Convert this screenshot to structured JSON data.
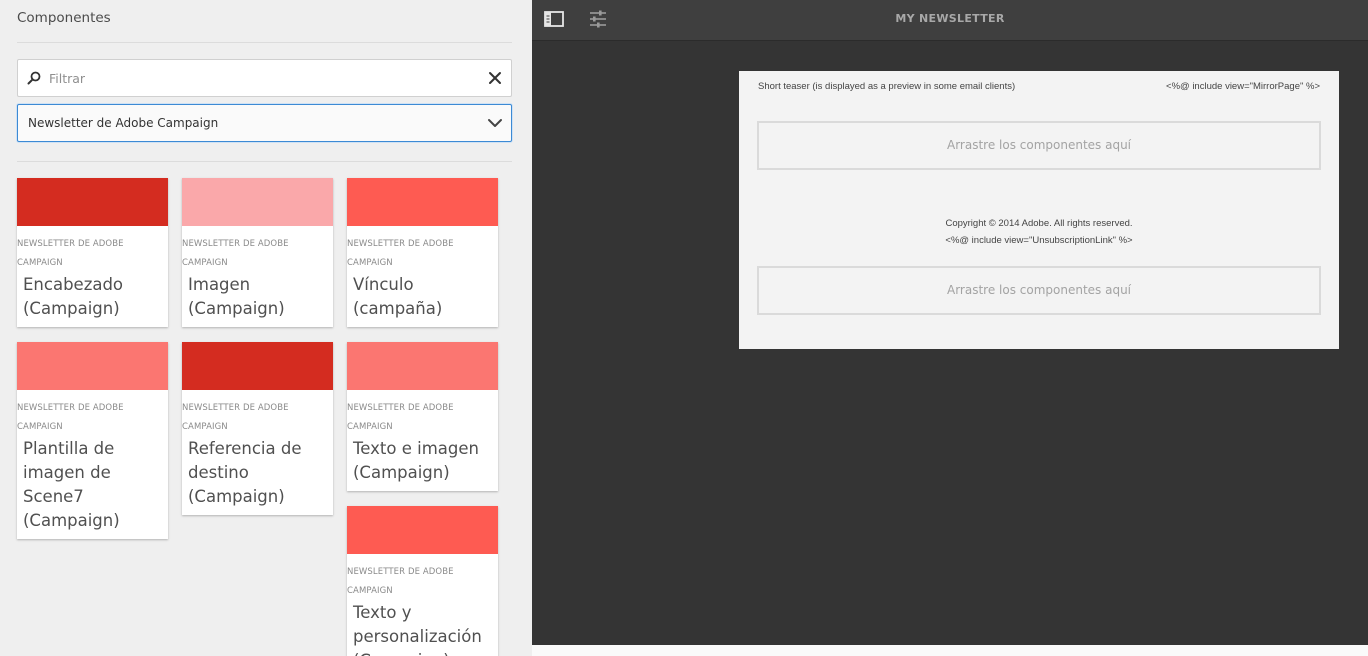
{
  "sidebar": {
    "title": "Componentes",
    "search": {
      "placeholder": "Filtrar",
      "value": ""
    },
    "group_select": {
      "value": "Newsletter de Adobe Campaign"
    },
    "components": [
      {
        "group": "NEWSLETTER DE ADOBE CAMPAIGN",
        "title": "Encabezado (Campaign)",
        "color": "#d42c20"
      },
      {
        "group": "NEWSLETTER DE ADOBE CAMPAIGN",
        "title": "Imagen (Campaign)",
        "color": "#faa8aa"
      },
      {
        "group": "NEWSLETTER DE ADOBE CAMPAIGN",
        "title": "Vínculo (campaña)",
        "color": "#fe5b52"
      },
      {
        "group": "NEWSLETTER DE ADOBE CAMPAIGN",
        "title": "Plantilla de imagen de Scene7 (Campaign)",
        "color": "#fb7671"
      },
      {
        "group": "NEWSLETTER DE ADOBE CAMPAIGN",
        "title": "Referencia de destino (Campaign)",
        "color": "#d42c20"
      },
      {
        "group": "NEWSLETTER DE ADOBE CAMPAIGN",
        "title": "Texto e imagen (Campaign)",
        "color": "#fb7671"
      },
      {
        "group": "NEWSLETTER DE ADOBE CAMPAIGN",
        "title": "Texto y personalización (Campaign)",
        "color": "#fe5b52"
      }
    ]
  },
  "editor": {
    "page_title": "MY NEWSLETTER",
    "teaser": "Short teaser (is displayed as a preview in some email clients)",
    "mirror_include": "<%@ include view=\"MirrorPage\" %>",
    "dropzone_label": "Arrastre los componentes aquí",
    "copyright_line1": "Copyright © 2014 Adobe. All rights reserved.",
    "copyright_line2": "<%@ include view=\"UnsubscriptionLink\" %>",
    "icons": [
      "sidepanel-toggle-icon",
      "page-properties-icon"
    ]
  }
}
